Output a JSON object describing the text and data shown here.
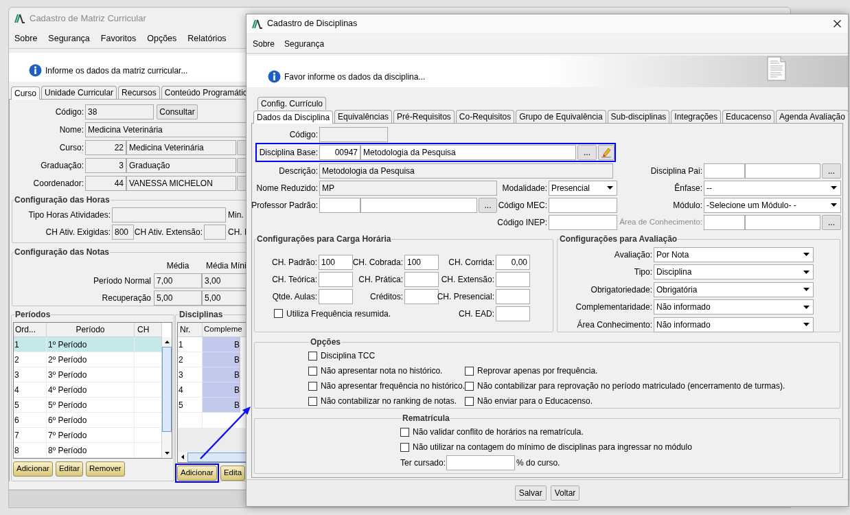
{
  "left_window": {
    "title": "Cadastro de Matriz Curricular",
    "menu": [
      "Sobre",
      "Segurança",
      "Favoritos",
      "Opções",
      "Relatórios"
    ],
    "info": "Informe os dados da matriz curricular...",
    "tabs": [
      {
        "label": "Curso",
        "selected": true
      },
      {
        "label": "Unidade Curricular",
        "selected": false
      },
      {
        "label": "Recursos",
        "selected": false
      },
      {
        "label": "Conteúdo Programátic",
        "selected": false
      }
    ],
    "codigo": {
      "label": "Código:",
      "value": "38",
      "button": "Consultar"
    },
    "nome": {
      "label": "Nome:",
      "value": "Medicina Veterinária"
    },
    "lookups": [
      {
        "label": "Curso:",
        "code": "22",
        "value": "Medicina Veterinária"
      },
      {
        "label": "Graduação:",
        "code": "3",
        "value": "Graduação"
      },
      {
        "label": "Coordenador:",
        "code": "44",
        "value": "VANESSA MICHELON"
      }
    ],
    "horas": {
      "title": "Configuração das Horas",
      "tipo_label": "Tipo Horas Atividades:",
      "min_label": "Min.",
      "exigidas_label": "CH Ativ. Exigidas:",
      "exigidas_value": "800",
      "extensao_label": "CH Ativ. Extensão:",
      "column_cut": "CH. I"
    },
    "notas": {
      "title": "Configuração das Notas",
      "columns": [
        "Média",
        "Média Míni"
      ],
      "rows": [
        {
          "label": "Período Normal",
          "values": [
            "7,00",
            "3,00"
          ]
        },
        {
          "label": "Recuperação",
          "values": [
            "5,00",
            "5,00"
          ]
        }
      ]
    },
    "periodos": {
      "title": "Períodos",
      "columns": [
        "Ord...",
        "Período",
        "CH"
      ],
      "rows": [
        {
          "order": "1",
          "name": "1º Período",
          "selected": true
        },
        {
          "order": "2",
          "name": "2º Período",
          "selected": false
        },
        {
          "order": "3",
          "name": "3º Período",
          "selected": false
        },
        {
          "order": "4",
          "name": "4º Período",
          "selected": false
        },
        {
          "order": "5",
          "name": "5º Período",
          "selected": false
        },
        {
          "order": "6",
          "name": "6º Período",
          "selected": false
        },
        {
          "order": "7",
          "name": "7º Período",
          "selected": false
        },
        {
          "order": "8",
          "name": "8º Período",
          "selected": false
        }
      ],
      "buttons": [
        "Adicionar",
        "Editar",
        "Remover"
      ]
    },
    "disciplinas": {
      "title": "Disciplinas",
      "columns": [
        "Nr.",
        "Compleme"
      ],
      "rows": [
        {
          "nr": "1",
          "column_2": "B"
        },
        {
          "nr": "2",
          "column_2": "B"
        },
        {
          "nr": "3",
          "column_2": "B"
        },
        {
          "nr": "4",
          "column_2": "B"
        },
        {
          "nr": "5",
          "column_2": "B"
        }
      ],
      "buttons": [
        "Adicionar",
        "Edita"
      ]
    }
  },
  "dialog": {
    "title": "Cadastro de Disciplinas",
    "menu": [
      "Sobre",
      "Segurança"
    ],
    "info": "Favor informe os dados da disciplina...",
    "tabs_top": [
      {
        "label": "Config. Currículo",
        "selected": false
      }
    ],
    "tabs": [
      {
        "label": "Dados da Disciplina",
        "selected": true
      },
      {
        "label": "Equivalências",
        "selected": false
      },
      {
        "label": "Pré-Requisitos",
        "selected": false
      },
      {
        "label": "Co-Requisitos",
        "selected": false
      },
      {
        "label": "Grupo de Equivalência",
        "selected": false
      },
      {
        "label": "Sub-disciplinas",
        "selected": false
      },
      {
        "label": "Integrações",
        "selected": false
      },
      {
        "label": "Educacenso",
        "selected": false
      },
      {
        "label": "Agenda Avaliação",
        "selected": false
      }
    ],
    "codigo": {
      "label": "Código:"
    },
    "disciplina_base": {
      "label": "Disciplina Base:",
      "code": "00947",
      "value": "Metodologia da Pesquisa",
      "lookup": "..."
    },
    "descricao": {
      "label": "Descrição:",
      "value": "Metodologia da Pesquisa"
    },
    "nome_reduzido": {
      "label": "Nome Reduzido:",
      "value": "MP"
    },
    "modalidade": {
      "label": "Modalidade:",
      "value": "Presencial"
    },
    "professor": {
      "label": "Professor Padrão:",
      "lookup": "..."
    },
    "codigo_mec": {
      "label": "Código MEC:"
    },
    "codigo_inep": {
      "label": "Código INEP:"
    },
    "disciplina_pai": {
      "label": "Disciplina Pai:",
      "lookup": "..."
    },
    "enfase": {
      "label": "Ênfase:",
      "value": "--"
    },
    "modulo": {
      "label": "Módulo:",
      "value": "-Selecione um Módulo- -"
    },
    "area": {
      "label": "Área de Conhecimento:",
      "lookup": "...",
      "disabled": true
    },
    "carga": {
      "title": "Configurações para Carga Horária",
      "fields": [
        {
          "label": "CH. Padrão:",
          "value": "100"
        },
        {
          "label": "CH. Cobrada:",
          "value": "100"
        },
        {
          "label": "CH. Corrida:",
          "value": "0,00"
        },
        {
          "label": "CH. Teórica:"
        },
        {
          "label": "CH. Prática:"
        },
        {
          "label": "CH. Extensão:"
        },
        {
          "label": "Qtde. Aulas:"
        },
        {
          "label": "Créditos:"
        },
        {
          "label": "CH. Presencial:"
        }
      ],
      "checkbox": {
        "label": "Utiliza Frequência resumida.",
        "checked": false
      },
      "ead": {
        "label": "CH. EAD:"
      }
    },
    "avaliacao": {
      "title": "Configurações para Avaliação",
      "selects": [
        {
          "label": "Avaliação:",
          "value": "Por Nota"
        },
        {
          "label": "Tipo:",
          "value": "Disciplina"
        },
        {
          "label": "Obrigatoriedade:",
          "value": "Obrigatória"
        },
        {
          "label": "Complementaridade:",
          "value": "Não informado"
        },
        {
          "label": "Área Conhecimento:",
          "value": "Não informado"
        }
      ]
    },
    "opcoes": {
      "title": "Opções",
      "rows": [
        {
          "items": [
            {
              "label": "Disciplina TCC",
              "checked": false
            }
          ]
        },
        {
          "items": [
            {
              "label": "Não apresentar nota no histórico.",
              "checked": false
            },
            {
              "label": "Reprovar apenas por frequência.",
              "checked": false
            }
          ]
        },
        {
          "items": [
            {
              "label": "Não apresentar frequência no histórico.",
              "checked": false
            },
            {
              "label": "Não contabilizar para reprovação no período matriculado (encerramento de turmas).",
              "checked": false
            }
          ]
        },
        {
          "items": [
            {
              "label": "Não contabilizar no ranking de notas.",
              "checked": false
            },
            {
              "label": "Não enviar para o Educacenso.",
              "checked": false
            }
          ]
        }
      ]
    },
    "rematricula": {
      "title": "Rematrícula",
      "items": [
        {
          "label": "Não validar conflito de horários na rematrícula.",
          "checked": false
        },
        {
          "label": "Não utilizar na contagem do mínimo de disciplinas para ingressar no módulo",
          "checked": false
        }
      ],
      "ter_cursado": {
        "label": "Ter cursado:",
        "suffix": "% do curso."
      }
    },
    "buttons": [
      "Salvar",
      "Voltar"
    ]
  }
}
